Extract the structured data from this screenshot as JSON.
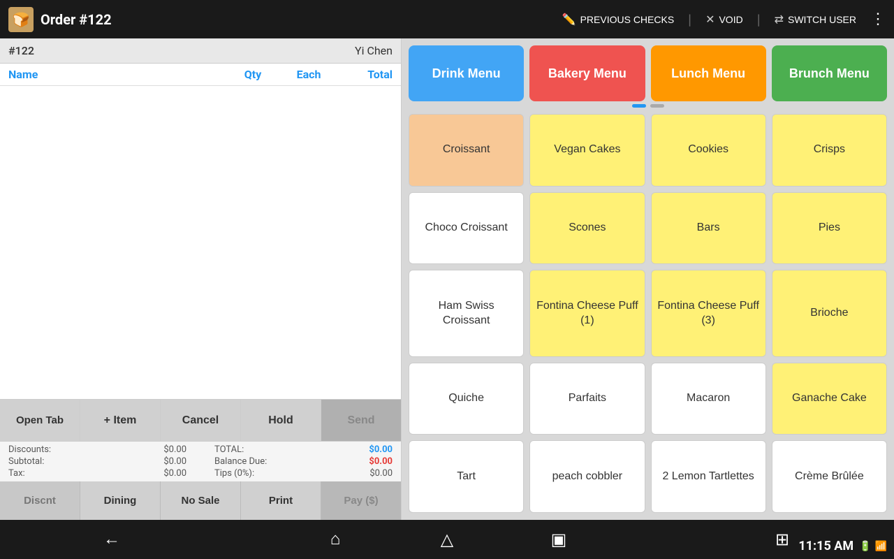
{
  "topbar": {
    "order_title": "Order #122",
    "prev_checks_label": "PREVIOUS CHECKS",
    "void_label": "VOID",
    "switch_user_label": "SWITCH USER"
  },
  "left_panel": {
    "order_num": "#122",
    "customer_name": "Yi Chen",
    "columns": {
      "name": "Name",
      "qty": "Qty",
      "each": "Each",
      "total": "Total"
    },
    "action_buttons": {
      "open_tab": "Open Tab",
      "item": "+ Item",
      "cancel": "Cancel",
      "hold": "Hold",
      "send": "Send"
    },
    "totals": {
      "discounts_label": "Discounts:",
      "discounts_value": "$0.00",
      "total_label": "TOTAL:",
      "total_value": "$0.00",
      "subtotal_label": "Subtotal:",
      "subtotal_value": "$0.00",
      "balance_label": "Balance Due:",
      "balance_value": "$0.00",
      "tax_label": "Tax:",
      "tax_value": "$0.00",
      "tips_label": "Tips (0%):",
      "tips_value": "$0.00"
    },
    "bottom_buttons": {
      "discnt": "Discnt",
      "dining": "Dining",
      "no_sale": "No Sale",
      "print": "Print",
      "pay": "Pay ($)"
    }
  },
  "right_panel": {
    "menu_tabs": [
      {
        "label": "Drink Menu",
        "type": "drink"
      },
      {
        "label": "Bakery Menu",
        "type": "bakery"
      },
      {
        "label": "Lunch Menu",
        "type": "lunch"
      },
      {
        "label": "Brunch Menu",
        "type": "brunch"
      }
    ],
    "menu_items": [
      {
        "label": "Croissant",
        "style": "peach"
      },
      {
        "label": "Vegan Cakes",
        "style": "yellow"
      },
      {
        "label": "Cookies",
        "style": "yellow"
      },
      {
        "label": "Crisps",
        "style": "yellow"
      },
      {
        "label": "Choco Croissant",
        "style": "white"
      },
      {
        "label": "Scones",
        "style": "yellow"
      },
      {
        "label": "Bars",
        "style": "yellow"
      },
      {
        "label": "Pies",
        "style": "yellow"
      },
      {
        "label": "Ham Swiss Croissant",
        "style": "white"
      },
      {
        "label": "Fontina Cheese Puff (1)",
        "style": "yellow"
      },
      {
        "label": "Fontina Cheese Puff (3)",
        "style": "yellow"
      },
      {
        "label": "Brioche",
        "style": "yellow"
      },
      {
        "label": "Quiche",
        "style": "white"
      },
      {
        "label": "Parfaits",
        "style": "white"
      },
      {
        "label": "Macaron",
        "style": "white"
      },
      {
        "label": "Ganache Cake",
        "style": "yellow"
      },
      {
        "label": "Tart",
        "style": "white"
      },
      {
        "label": "peach cobbler",
        "style": "white"
      },
      {
        "label": "2 Lemon Tartlettes",
        "style": "white"
      },
      {
        "label": "Crème Brûlée",
        "style": "white"
      }
    ]
  },
  "bottom_nav": {
    "time": "11:15 AM"
  }
}
